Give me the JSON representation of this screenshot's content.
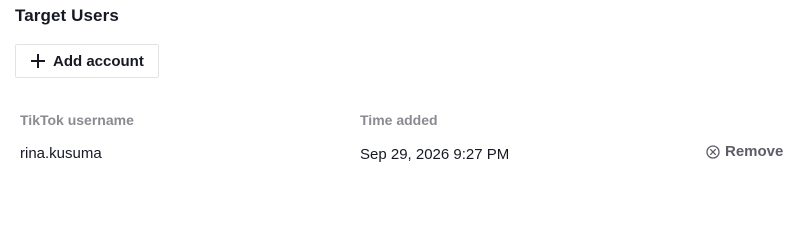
{
  "section": {
    "title": "Target Users"
  },
  "actions": {
    "add_account_label": "Add account",
    "add_icon": "plus-icon"
  },
  "table": {
    "columns": {
      "username": "TikTok username",
      "time_added": "Time added"
    },
    "rows": [
      {
        "username": "rina.kusuma",
        "time_added": "Sep 29, 2026 9:27 PM",
        "remove_label": "Remove",
        "remove_icon": "circle-x-icon"
      }
    ]
  }
}
